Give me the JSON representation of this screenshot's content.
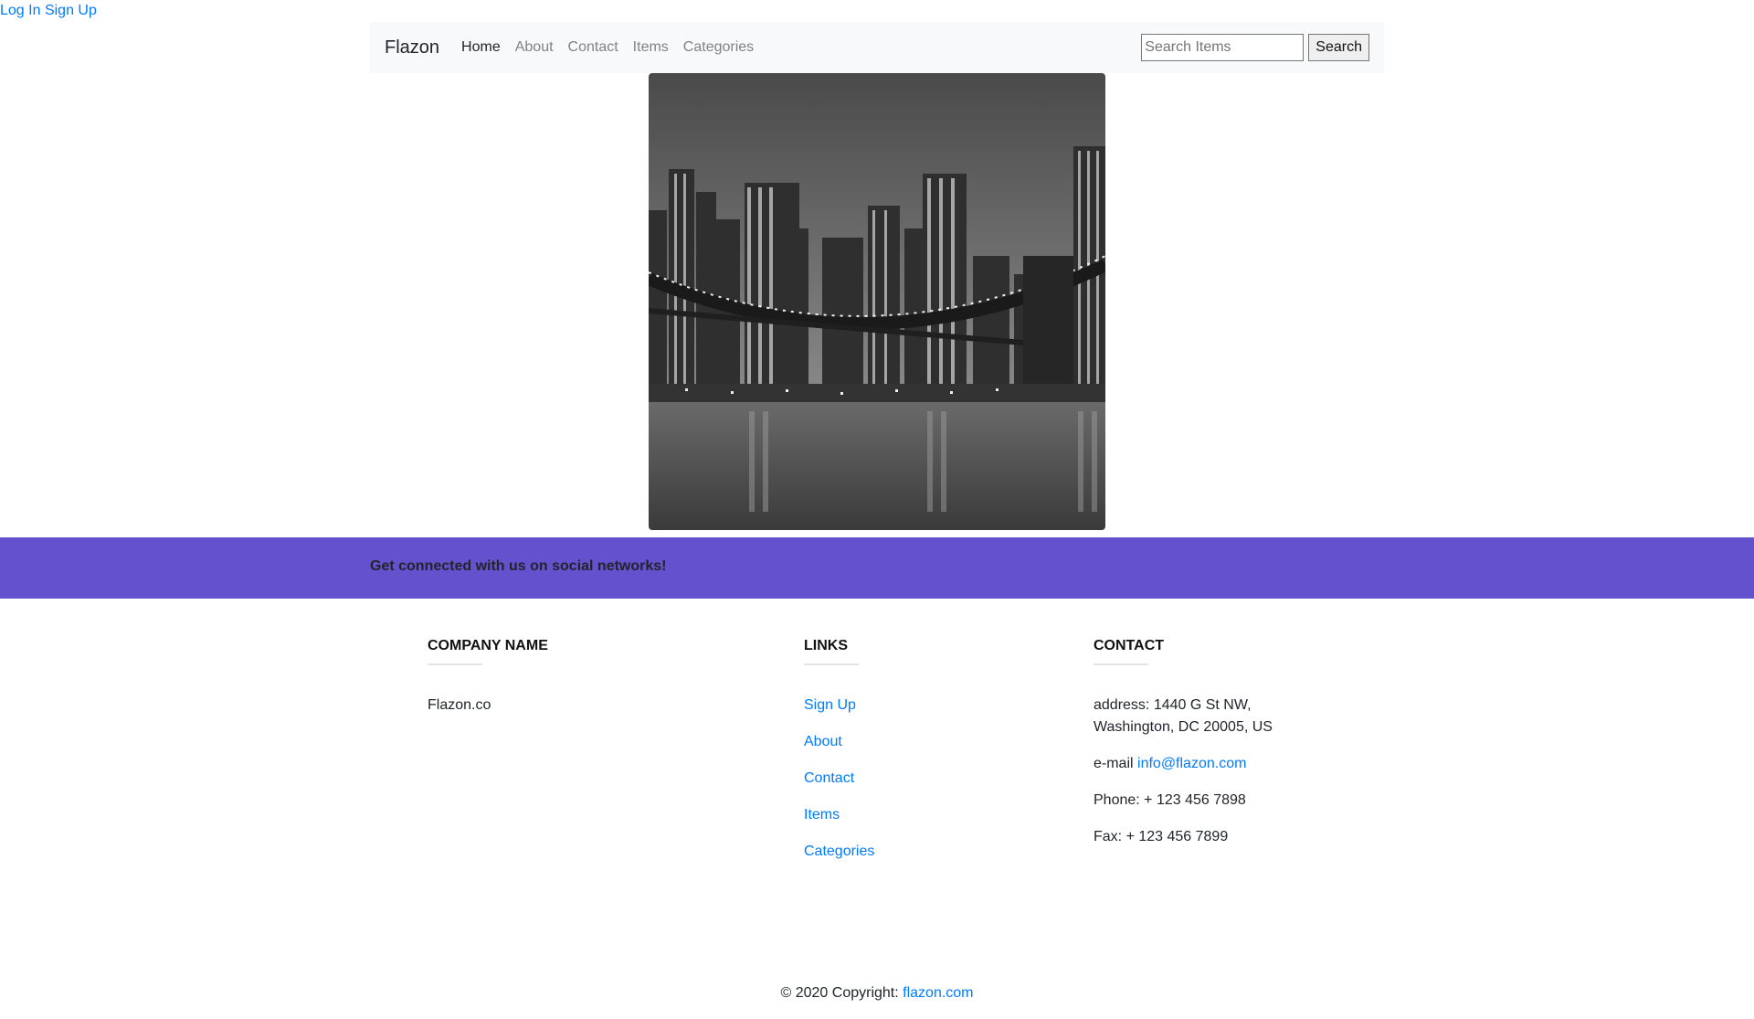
{
  "auth": {
    "login": "Log In",
    "signup": "Sign Up"
  },
  "navbar": {
    "brand": "Flazon",
    "links": [
      "Home",
      "About",
      "Contact",
      "Items",
      "Categories"
    ],
    "active": "Home",
    "search_placeholder": "Search Items",
    "search_value": "",
    "search_button": "Search"
  },
  "hero": {
    "subject": "city skyline at night with bridge (grayscale)"
  },
  "social": {
    "text": "Get connected with us on social networks!",
    "band_color": "#6351ce"
  },
  "footer": {
    "company": {
      "title": "COMPANY NAME",
      "text": "Flazon.co"
    },
    "links": {
      "title": "LINKS",
      "items": [
        "Sign Up",
        "About",
        "Contact",
        "Items",
        "Categories"
      ]
    },
    "contact": {
      "title": "CONTACT",
      "address_line1": "address: 1440 G St NW,",
      "address_line2": "Washington, DC 20005, US",
      "email_label": "e-mail",
      "email": "info@flazon.com",
      "phone": "Phone: + 123 456 7898",
      "fax": "Fax: + 123 456 7899"
    }
  },
  "copyright": {
    "text": "© 2020 Copyright:",
    "link": "flazon.com"
  },
  "colors": {
    "link": "#007bff",
    "navbar_bg": "#f8f9fa",
    "accent": "#6351ce"
  }
}
